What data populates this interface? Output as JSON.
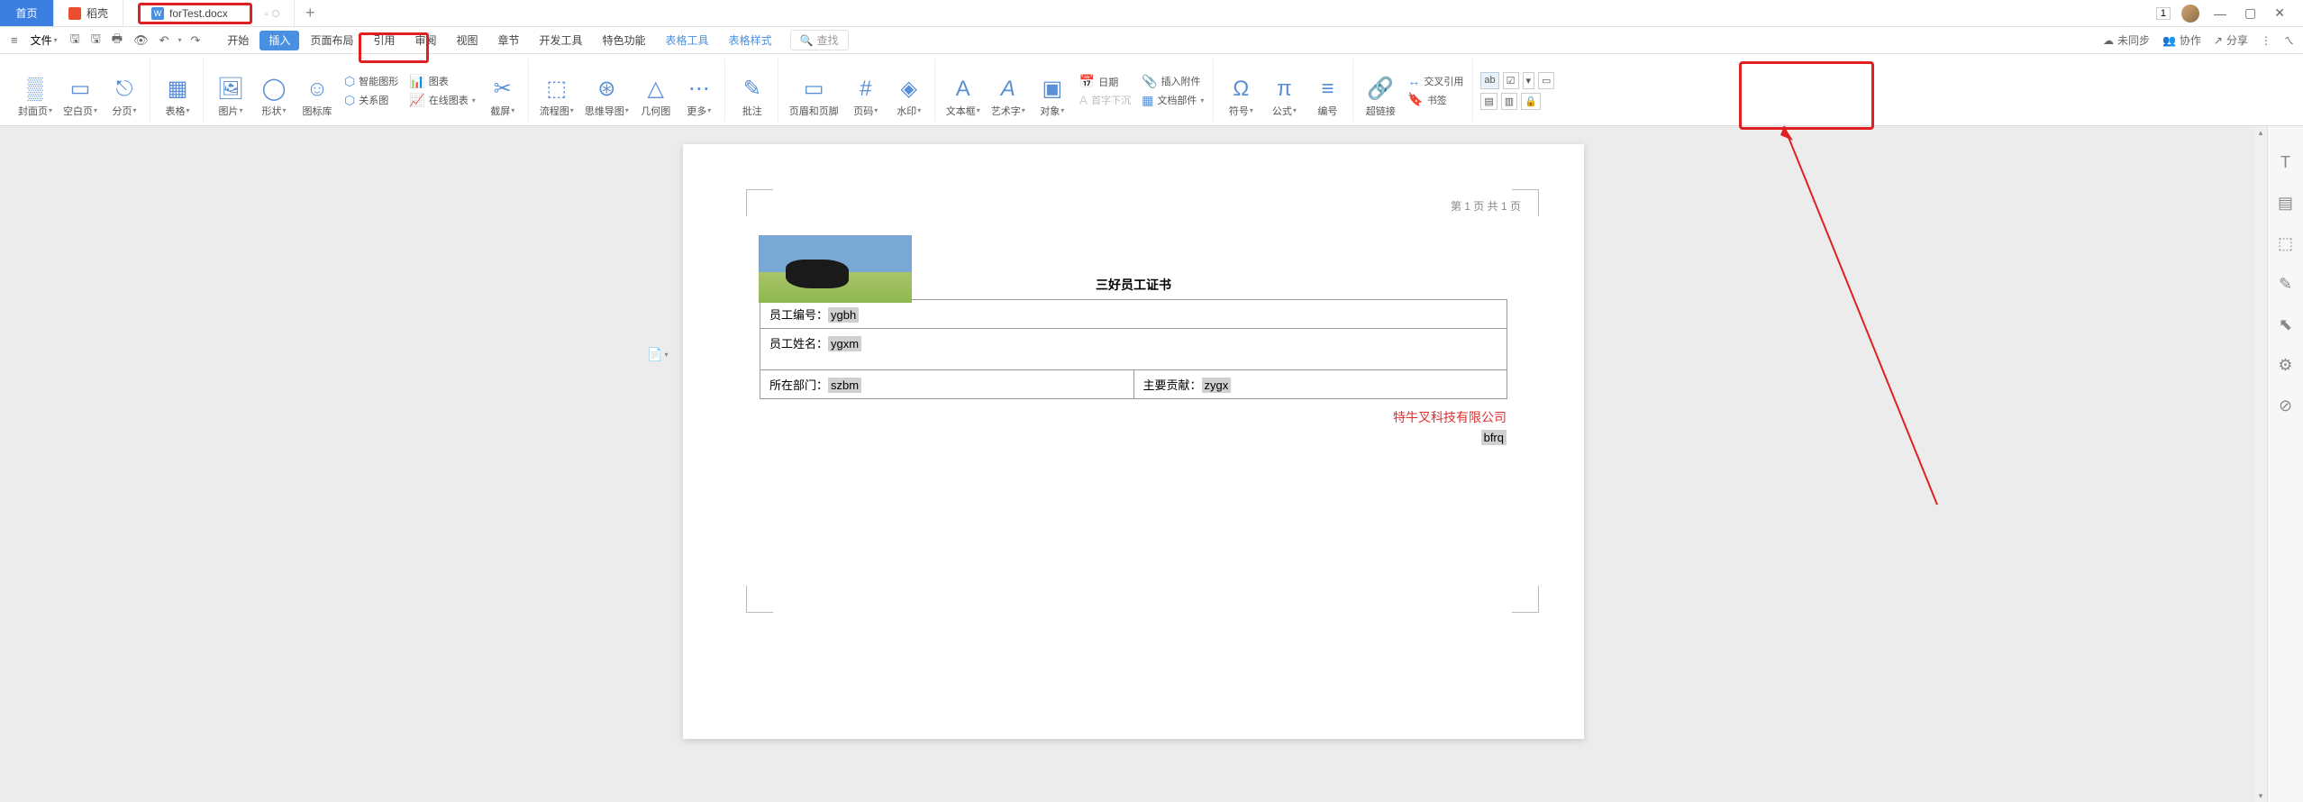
{
  "tabs": {
    "home": "首页",
    "docker": "稻壳",
    "active_file": "forTest.docx"
  },
  "window": {
    "badge": "1"
  },
  "file_menu": "文件",
  "menu_tabs": {
    "start": "开始",
    "insert": "插入",
    "page_layout": "页面布局",
    "reference": "引用",
    "review": "审阅",
    "view": "视图",
    "chapter": "章节",
    "dev": "开发工具",
    "special": "特色功能",
    "table_tools": "表格工具",
    "table_style": "表格样式"
  },
  "search_label": "查找",
  "sync_status": "未同步",
  "collab": "协作",
  "share": "分享",
  "ribbon": {
    "cover": "封面页",
    "blank": "空白页",
    "page_break": "分页",
    "table": "表格",
    "picture": "图片",
    "shape": "形状",
    "gallery": "图标库",
    "smart_graphic": "智能图形",
    "chart": "图表",
    "relation": "关系图",
    "online_chart": "在线图表",
    "screenshot": "截屏",
    "flowchart": "流程图",
    "mindmap": "思维导图",
    "geometry": "几何图",
    "more": "更多",
    "comment": "批注",
    "header_footer": "页眉和页脚",
    "page_number": "页码",
    "watermark": "水印",
    "textbox": "文本框",
    "wordart": "艺术字",
    "object": "对象",
    "date": "日期",
    "dropcap": "首字下沉",
    "attachment": "插入附件",
    "doc_part": "文档部件",
    "symbol": "符号",
    "equation": "公式",
    "number": "编号",
    "hyperlink": "超链接",
    "cross_ref": "交叉引用",
    "bookmark": "书签"
  },
  "document": {
    "page_info": "第 1 页 共 1 页",
    "title": "三好员工证书",
    "row1_label": "员工编号：",
    "row1_val": "ygbh",
    "row2_label": "员工姓名：",
    "row2_val": "ygxm",
    "row3a_label": "所在部门：",
    "row3a_val": "szbm",
    "row3b_label": "主要贡献：",
    "row3b_val": "zygx",
    "company": "特牛叉科技有限公司",
    "date_field": "bfrq"
  }
}
